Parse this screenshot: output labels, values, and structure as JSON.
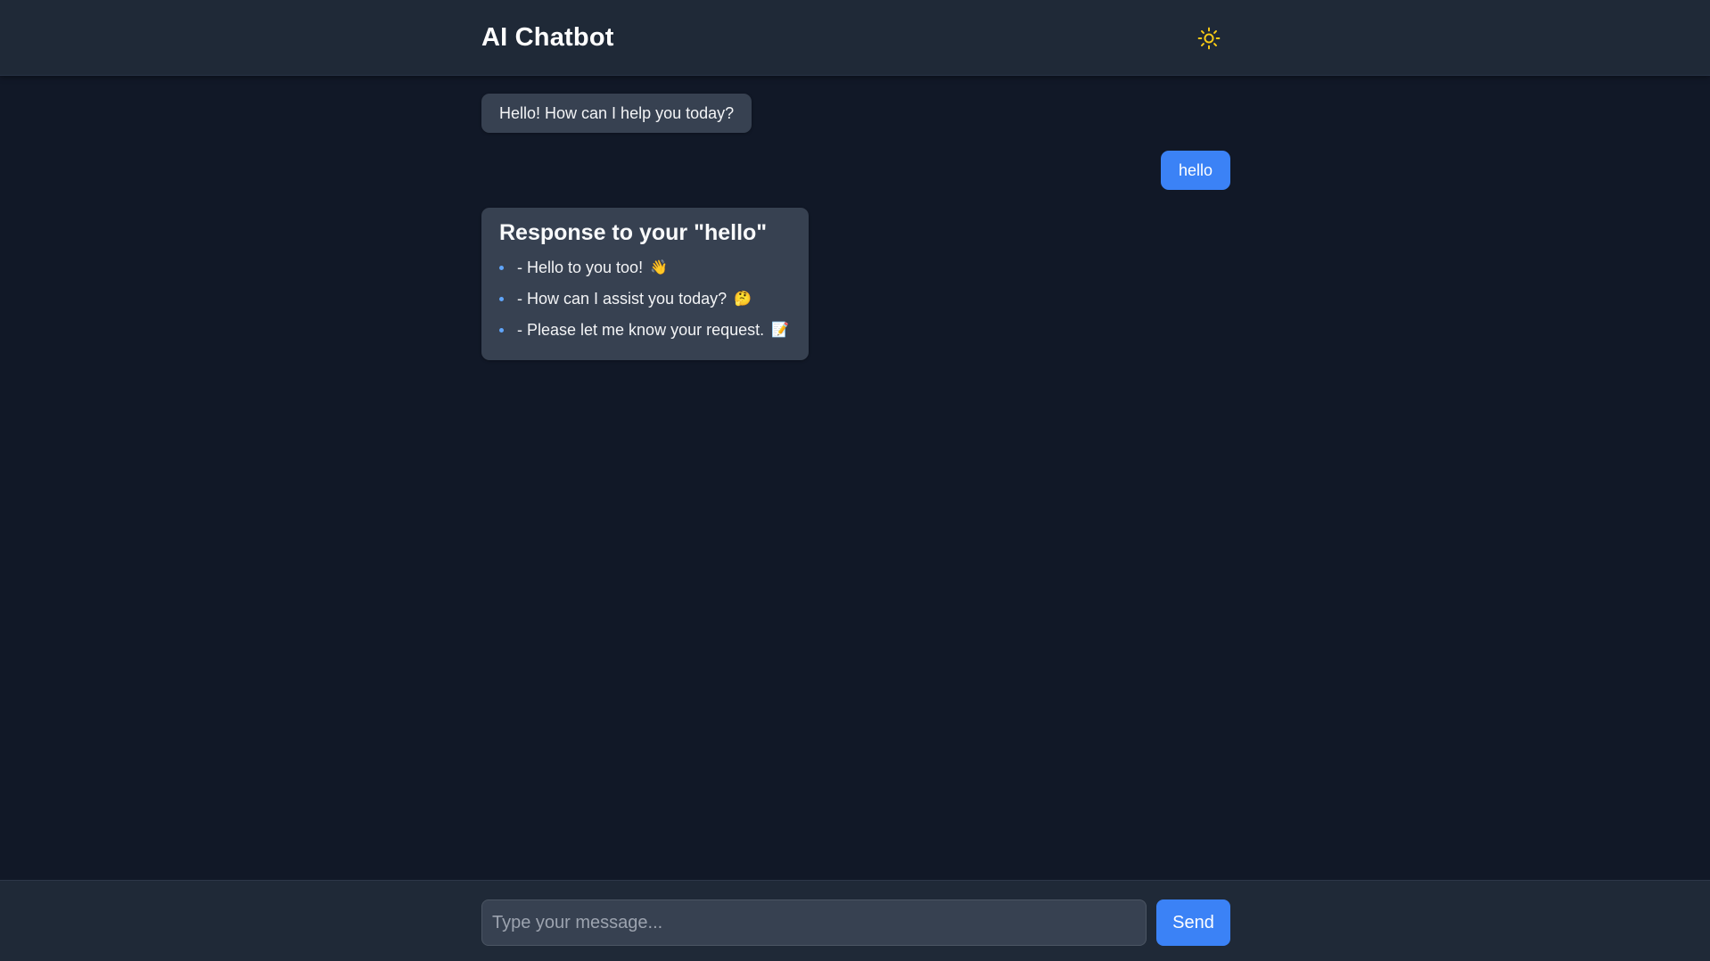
{
  "header": {
    "title": "AI Chatbot",
    "theme_toggle_icon": "sun-icon"
  },
  "messages": {
    "greeting": "Hello! How can I help you today?",
    "user_message": "hello",
    "response": {
      "title": "Response to your \"hello\"",
      "items": [
        {
          "text": "- Hello to you too!",
          "emoji": "👋"
        },
        {
          "text": "- How can I assist you today?",
          "emoji": "🤔"
        },
        {
          "text": "- Please let me know your request.",
          "emoji": "📝"
        }
      ]
    }
  },
  "composer": {
    "placeholder": "Type your message...",
    "value": "",
    "send_label": "Send"
  },
  "colors": {
    "background": "#111827",
    "header": "#1f2937",
    "bot_bubble": "#374151",
    "user_bubble": "#3b82f6",
    "accent": "#3b82f6",
    "sun": "#facc15"
  }
}
